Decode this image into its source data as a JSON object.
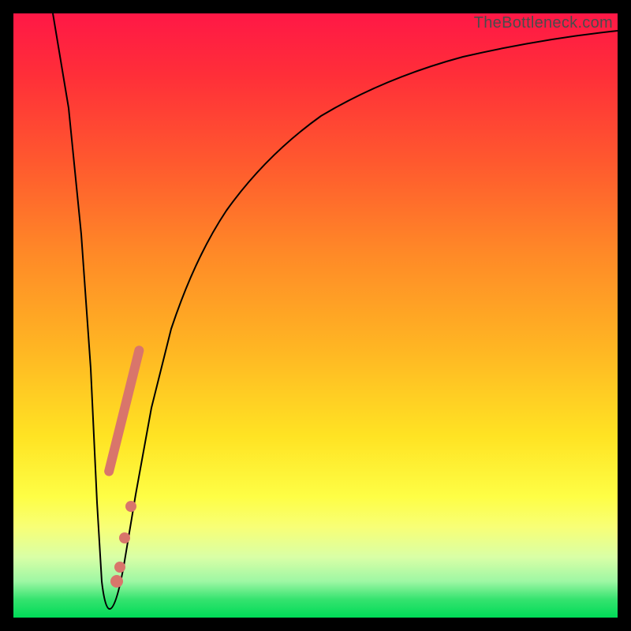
{
  "watermark": "TheBottleneck.com",
  "chart_data": {
    "type": "line",
    "title": "",
    "xlabel": "",
    "ylabel": "",
    "xlim": [
      0,
      100
    ],
    "ylim": [
      0,
      100
    ],
    "grid": false,
    "legend": false,
    "series": [
      {
        "name": "bottleneck-curve",
        "x": [
          0,
          3,
          6,
          9,
          11,
          12,
          13,
          14,
          15,
          18,
          22,
          26,
          30,
          35,
          40,
          46,
          54,
          64,
          76,
          90,
          100
        ],
        "y": [
          100,
          80,
          58,
          30,
          6,
          2,
          2,
          4,
          10,
          28,
          46,
          58,
          66,
          73,
          78,
          82,
          86,
          89,
          92,
          94,
          95
        ]
      }
    ],
    "annotations": {
      "highlight_segment": {
        "x_start": 16,
        "x_end": 23,
        "note": "salmon marker band on rising arm"
      },
      "highlight_points_x": [
        14.5,
        15.2,
        16.0
      ]
    },
    "colors": {
      "curve": "#000000",
      "markers": "#d9756b",
      "gradient_top": "#ff1846",
      "gradient_mid": "#ffe323",
      "gradient_bottom": "#00db58",
      "frame": "#000000"
    }
  }
}
